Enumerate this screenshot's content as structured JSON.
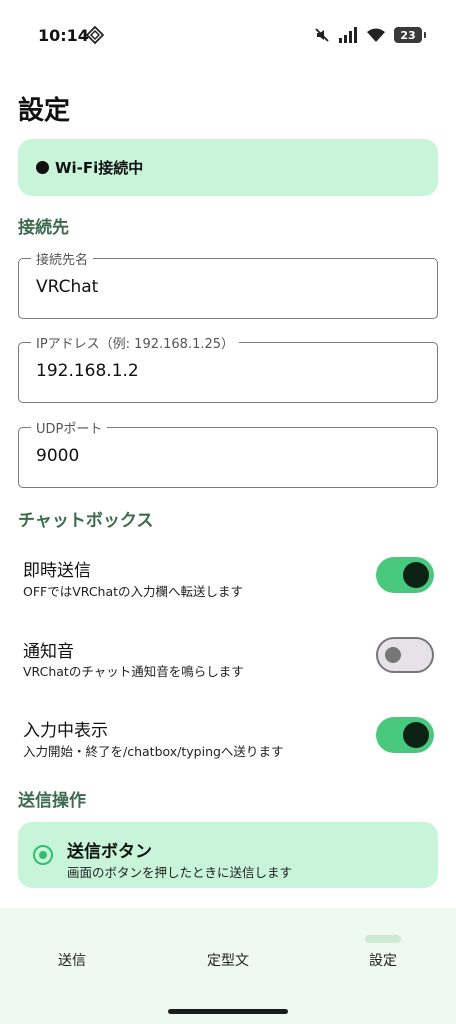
{
  "status_bar": {
    "time": "10:14",
    "battery": "23"
  },
  "page": {
    "title": "設定"
  },
  "connection_status": {
    "text": "Wi-Fi接続中"
  },
  "sections": {
    "connection": "接続先",
    "chatbox": "チャットボックス",
    "send_action": "送信操作"
  },
  "fields": {
    "name": {
      "label": "接続先名",
      "value": "VRChat"
    },
    "ip": {
      "label": "IPアドレス（例: 192.168.1.25）",
      "value": "192.168.1.2"
    },
    "port": {
      "label": "UDPポート",
      "value": "9000"
    }
  },
  "toggles": {
    "instant_send": {
      "title": "即時送信",
      "subtitle": "OFFではVRChatの入力欄へ転送します",
      "on": true
    },
    "notify_sound": {
      "title": "通知音",
      "subtitle": "VRChatのチャット通知音を鳴らします",
      "on": false
    },
    "typing_indicator": {
      "title": "入力中表示",
      "subtitle": "入力開始・終了を/chatbox/typingへ送ります",
      "on": true
    }
  },
  "send_option": {
    "title": "送信ボタン",
    "subtitle": "画面のボタンを押したときに送信します",
    "selected": true
  },
  "bottom_nav": {
    "send": "送信",
    "templates": "定型文",
    "settings": "設定",
    "active": "settings"
  },
  "colors": {
    "accent": "#49c97d",
    "card": "#c8f5d9",
    "section": "#3d6b4e",
    "nav_bg": "#eef9f1"
  }
}
